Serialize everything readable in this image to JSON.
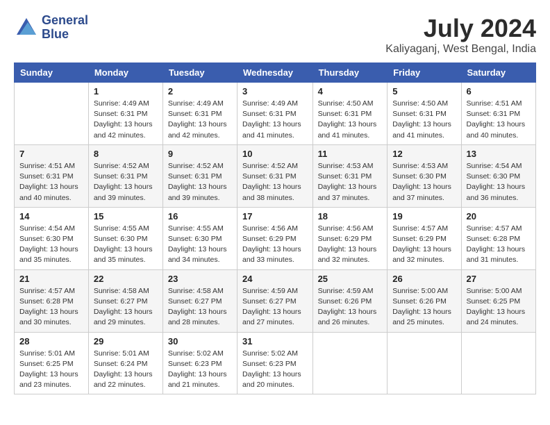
{
  "header": {
    "logo_line1": "General",
    "logo_line2": "Blue",
    "month_year": "July 2024",
    "location": "Kaliyaganj, West Bengal, India"
  },
  "columns": [
    "Sunday",
    "Monday",
    "Tuesday",
    "Wednesday",
    "Thursday",
    "Friday",
    "Saturday"
  ],
  "weeks": [
    [
      {
        "day": "",
        "info": ""
      },
      {
        "day": "1",
        "info": "Sunrise: 4:49 AM\nSunset: 6:31 PM\nDaylight: 13 hours\nand 42 minutes."
      },
      {
        "day": "2",
        "info": "Sunrise: 4:49 AM\nSunset: 6:31 PM\nDaylight: 13 hours\nand 42 minutes."
      },
      {
        "day": "3",
        "info": "Sunrise: 4:49 AM\nSunset: 6:31 PM\nDaylight: 13 hours\nand 41 minutes."
      },
      {
        "day": "4",
        "info": "Sunrise: 4:50 AM\nSunset: 6:31 PM\nDaylight: 13 hours\nand 41 minutes."
      },
      {
        "day": "5",
        "info": "Sunrise: 4:50 AM\nSunset: 6:31 PM\nDaylight: 13 hours\nand 41 minutes."
      },
      {
        "day": "6",
        "info": "Sunrise: 4:51 AM\nSunset: 6:31 PM\nDaylight: 13 hours\nand 40 minutes."
      }
    ],
    [
      {
        "day": "7",
        "info": "Sunrise: 4:51 AM\nSunset: 6:31 PM\nDaylight: 13 hours\nand 40 minutes."
      },
      {
        "day": "8",
        "info": "Sunrise: 4:52 AM\nSunset: 6:31 PM\nDaylight: 13 hours\nand 39 minutes."
      },
      {
        "day": "9",
        "info": "Sunrise: 4:52 AM\nSunset: 6:31 PM\nDaylight: 13 hours\nand 39 minutes."
      },
      {
        "day": "10",
        "info": "Sunrise: 4:52 AM\nSunset: 6:31 PM\nDaylight: 13 hours\nand 38 minutes."
      },
      {
        "day": "11",
        "info": "Sunrise: 4:53 AM\nSunset: 6:31 PM\nDaylight: 13 hours\nand 37 minutes."
      },
      {
        "day": "12",
        "info": "Sunrise: 4:53 AM\nSunset: 6:30 PM\nDaylight: 13 hours\nand 37 minutes."
      },
      {
        "day": "13",
        "info": "Sunrise: 4:54 AM\nSunset: 6:30 PM\nDaylight: 13 hours\nand 36 minutes."
      }
    ],
    [
      {
        "day": "14",
        "info": "Sunrise: 4:54 AM\nSunset: 6:30 PM\nDaylight: 13 hours\nand 35 minutes."
      },
      {
        "day": "15",
        "info": "Sunrise: 4:55 AM\nSunset: 6:30 PM\nDaylight: 13 hours\nand 35 minutes."
      },
      {
        "day": "16",
        "info": "Sunrise: 4:55 AM\nSunset: 6:30 PM\nDaylight: 13 hours\nand 34 minutes."
      },
      {
        "day": "17",
        "info": "Sunrise: 4:56 AM\nSunset: 6:29 PM\nDaylight: 13 hours\nand 33 minutes."
      },
      {
        "day": "18",
        "info": "Sunrise: 4:56 AM\nSunset: 6:29 PM\nDaylight: 13 hours\nand 32 minutes."
      },
      {
        "day": "19",
        "info": "Sunrise: 4:57 AM\nSunset: 6:29 PM\nDaylight: 13 hours\nand 32 minutes."
      },
      {
        "day": "20",
        "info": "Sunrise: 4:57 AM\nSunset: 6:28 PM\nDaylight: 13 hours\nand 31 minutes."
      }
    ],
    [
      {
        "day": "21",
        "info": "Sunrise: 4:57 AM\nSunset: 6:28 PM\nDaylight: 13 hours\nand 30 minutes."
      },
      {
        "day": "22",
        "info": "Sunrise: 4:58 AM\nSunset: 6:27 PM\nDaylight: 13 hours\nand 29 minutes."
      },
      {
        "day": "23",
        "info": "Sunrise: 4:58 AM\nSunset: 6:27 PM\nDaylight: 13 hours\nand 28 minutes."
      },
      {
        "day": "24",
        "info": "Sunrise: 4:59 AM\nSunset: 6:27 PM\nDaylight: 13 hours\nand 27 minutes."
      },
      {
        "day": "25",
        "info": "Sunrise: 4:59 AM\nSunset: 6:26 PM\nDaylight: 13 hours\nand 26 minutes."
      },
      {
        "day": "26",
        "info": "Sunrise: 5:00 AM\nSunset: 6:26 PM\nDaylight: 13 hours\nand 25 minutes."
      },
      {
        "day": "27",
        "info": "Sunrise: 5:00 AM\nSunset: 6:25 PM\nDaylight: 13 hours\nand 24 minutes."
      }
    ],
    [
      {
        "day": "28",
        "info": "Sunrise: 5:01 AM\nSunset: 6:25 PM\nDaylight: 13 hours\nand 23 minutes."
      },
      {
        "day": "29",
        "info": "Sunrise: 5:01 AM\nSunset: 6:24 PM\nDaylight: 13 hours\nand 22 minutes."
      },
      {
        "day": "30",
        "info": "Sunrise: 5:02 AM\nSunset: 6:23 PM\nDaylight: 13 hours\nand 21 minutes."
      },
      {
        "day": "31",
        "info": "Sunrise: 5:02 AM\nSunset: 6:23 PM\nDaylight: 13 hours\nand 20 minutes."
      },
      {
        "day": "",
        "info": ""
      },
      {
        "day": "",
        "info": ""
      },
      {
        "day": "",
        "info": ""
      }
    ]
  ]
}
